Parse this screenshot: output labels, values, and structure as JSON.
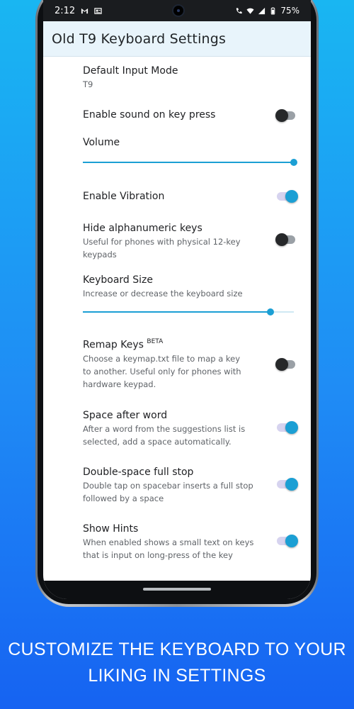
{
  "statusbar": {
    "time": "2:12",
    "battery": "75%"
  },
  "appbar": {
    "title": "Old T9 Keyboard Settings"
  },
  "prefs": {
    "input_mode": {
      "title": "Default Input Mode",
      "summary": "T9"
    },
    "sound": {
      "title": "Enable sound on key press",
      "enabled": false
    },
    "volume": {
      "title": "Volume",
      "value_fraction": 1.0
    },
    "vibration": {
      "title": "Enable Vibration",
      "enabled": true
    },
    "hide_alnum": {
      "title": "Hide alphanumeric keys",
      "summary_1": "Useful for phones with physical 12-key",
      "summary_2": "keypads",
      "enabled": false
    },
    "keyboard_size": {
      "title": "Keyboard Size",
      "summary": "Increase or decrease the keyboard size",
      "value_fraction": 0.89
    },
    "remap": {
      "title": "Remap Keys",
      "badge": "BETA",
      "summary_1": "Choose a keymap.txt file to map a key",
      "summary_2": "to another. Useful only for phones with",
      "summary_3": "hardware keypad.",
      "enabled": false
    },
    "space_after": {
      "title": "Space after word",
      "summary_1": "After a word from the suggestions list is",
      "summary_2": "selected, add a space automatically.",
      "enabled": true
    },
    "double_space": {
      "title": "Double-space full stop",
      "summary_1": "Double tap on spacebar inserts a full stop",
      "summary_2": "followed by a space",
      "enabled": true
    },
    "hints": {
      "title": "Show Hints",
      "summary_1": "When enabled shows a small text on keys",
      "summary_2": "that is input on long-press of the key",
      "enabled": true
    }
  },
  "caption": {
    "line1": "CUSTOMIZE THE KEYBOARD TO YOUR",
    "line2": "LIKING IN SETTINGS"
  },
  "colors": {
    "accent": "#1b9fd4",
    "appbar_bg": "#e8f4fb"
  }
}
